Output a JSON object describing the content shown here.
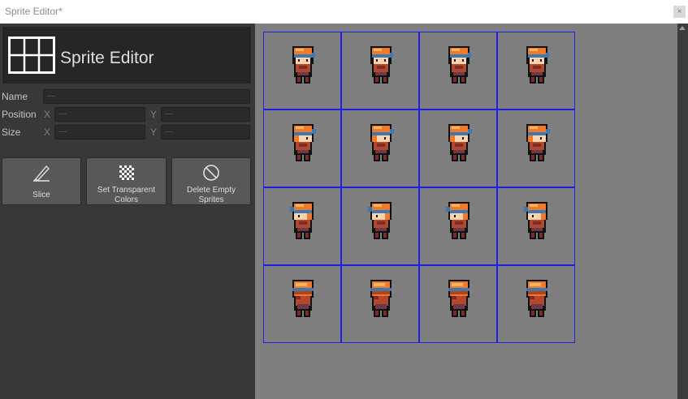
{
  "window": {
    "title": "Sprite Editor*",
    "close_glyph": "×"
  },
  "header": {
    "title": "Sprite Editor",
    "icon": "grid-icon"
  },
  "fields": {
    "name_label": "Name",
    "position_label": "Position",
    "size_label": "Size",
    "x_axis": "X",
    "y_axis": "Y",
    "name_value": "—",
    "position_x": "—",
    "position_y": "—",
    "size_x": "—",
    "size_y": "—"
  },
  "tools": {
    "slice_label": "Slice",
    "transparent_line1": "Set Transparent",
    "transparent_line2": "Colors",
    "delete_line1": "Delete Empty",
    "delete_line2": "Sprites"
  },
  "sprite_sheet": {
    "rows": 4,
    "columns": 4,
    "grid_color": "#1f20e6",
    "rows_facing": [
      "down",
      "right",
      "left",
      "up"
    ]
  },
  "colors": {
    "background": "#383838",
    "canvas": "#7f7f7f",
    "button": "#585858"
  }
}
